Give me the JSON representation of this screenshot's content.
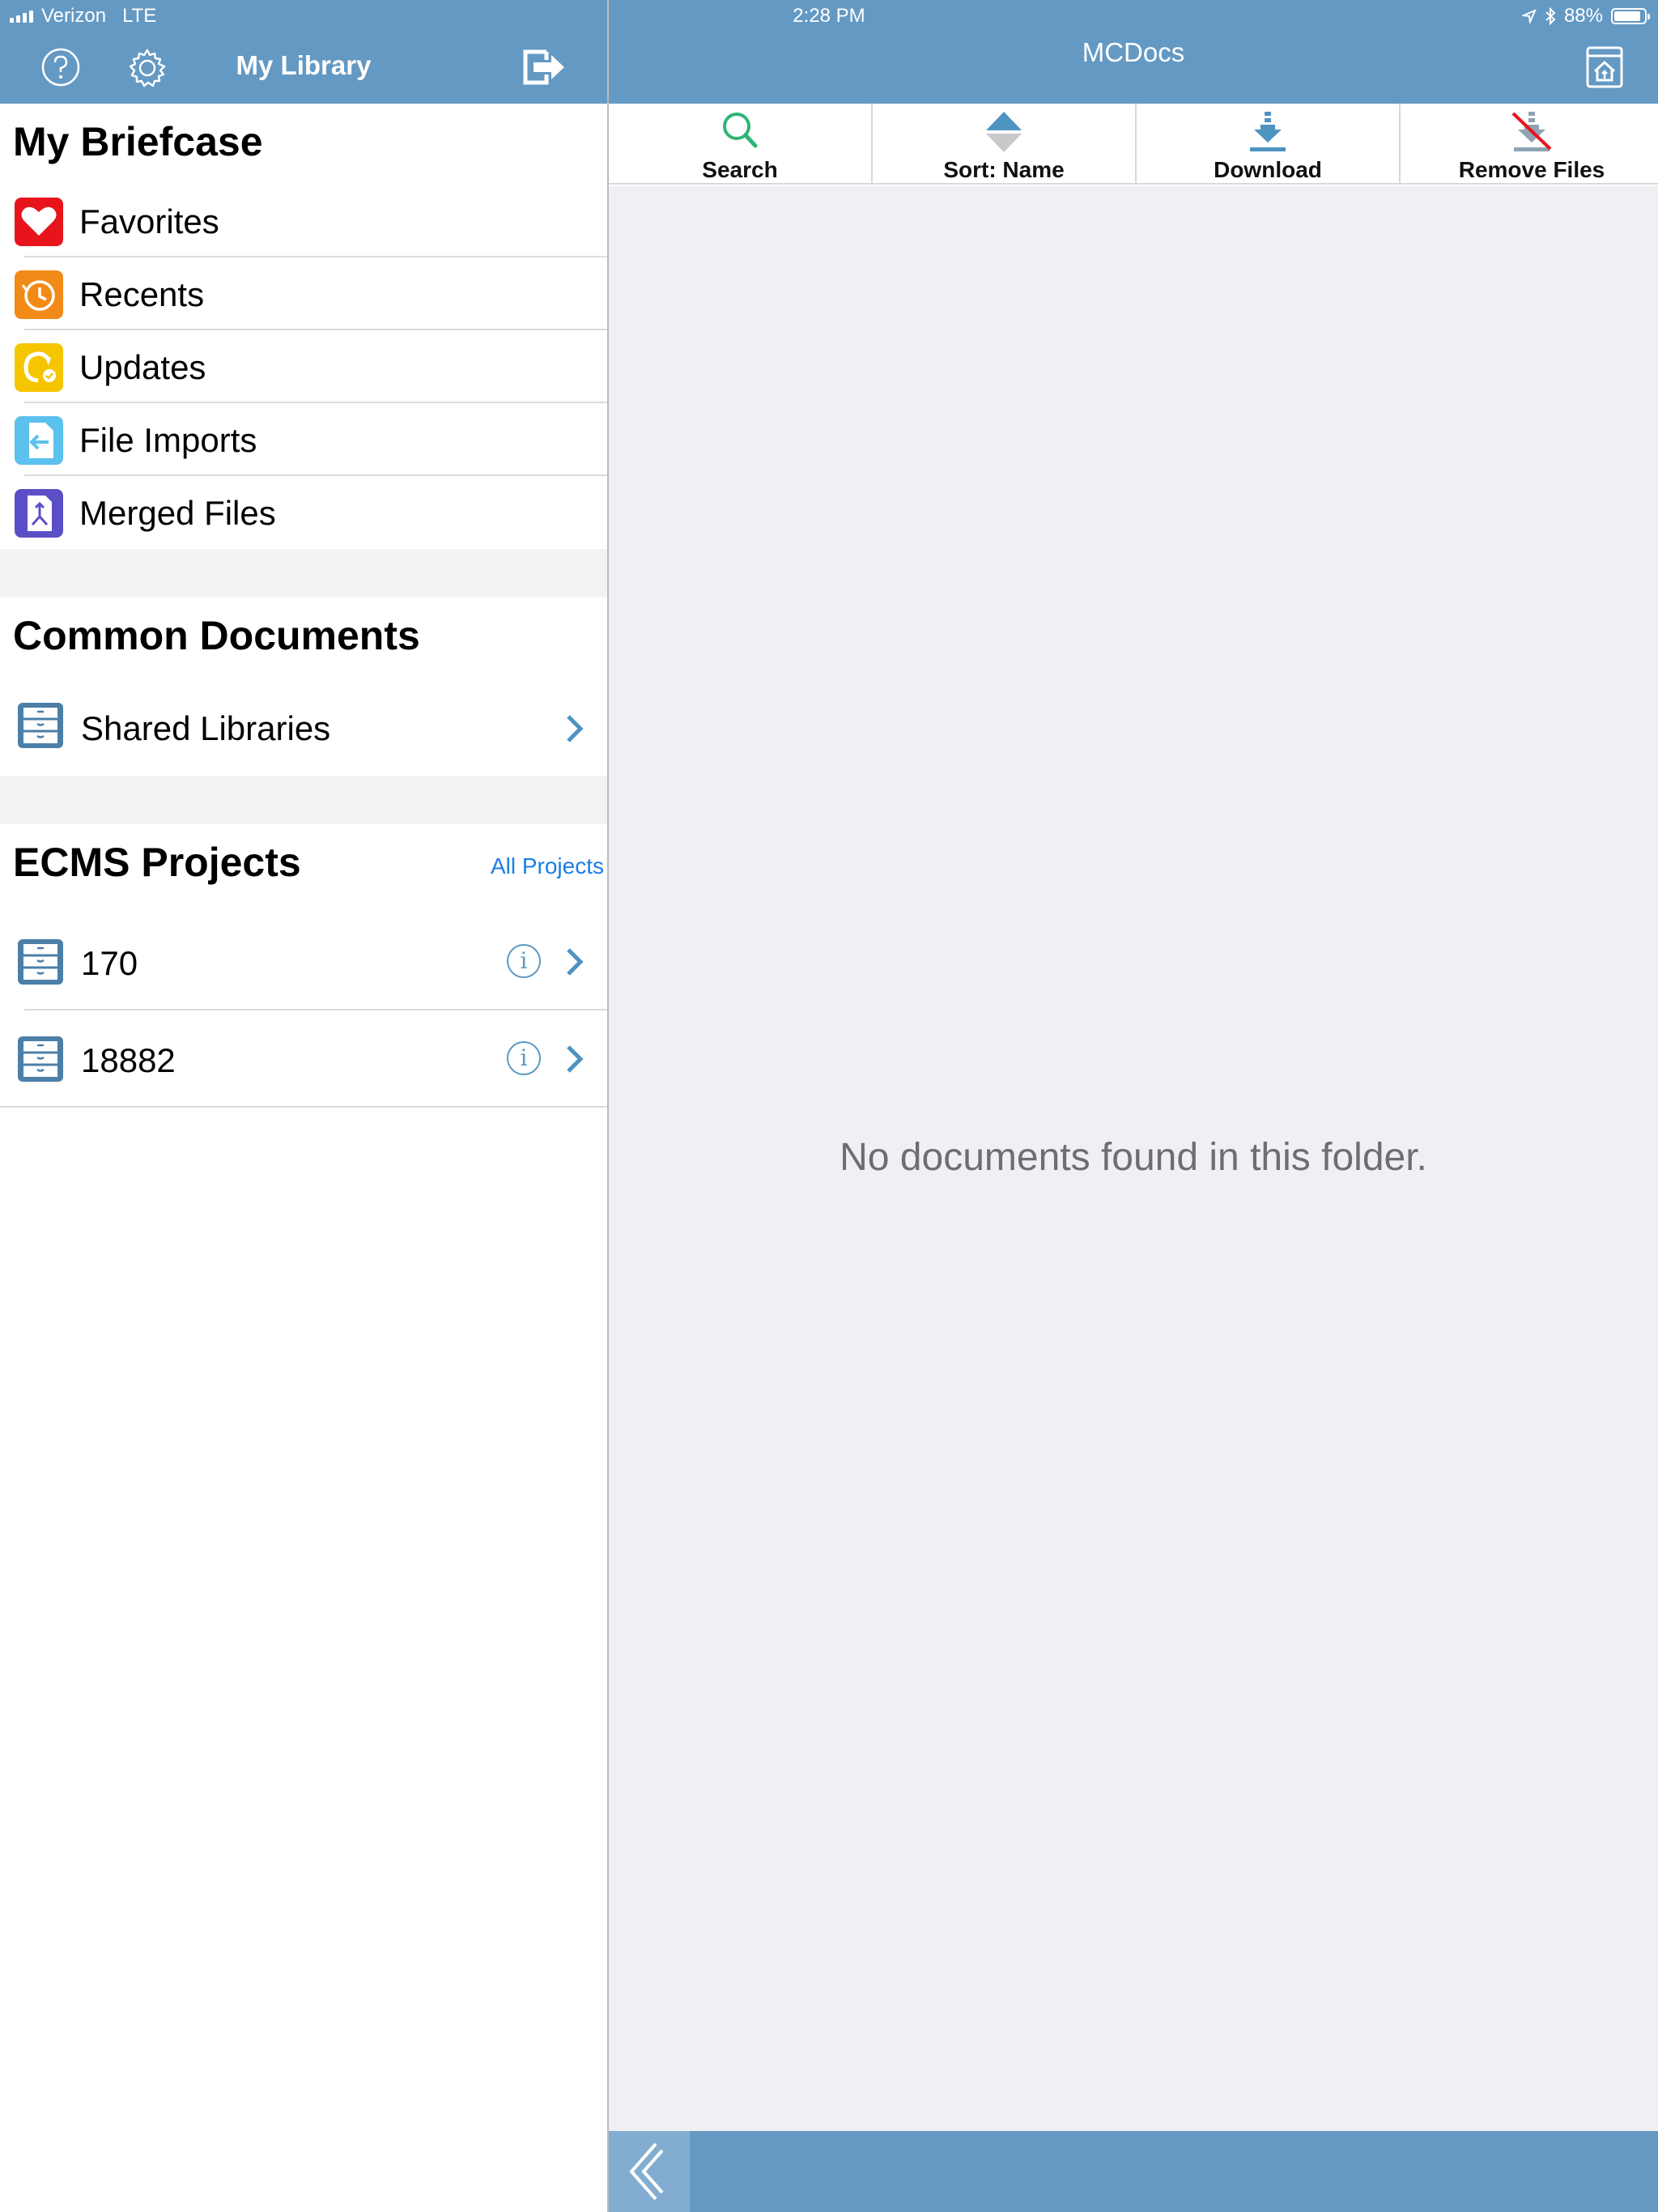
{
  "status_bar": {
    "carrier": "Verizon",
    "network": "LTE",
    "time": "2:28 PM",
    "battery": "88%",
    "battery_level": 0.88
  },
  "left_nav": {
    "title": "My Library",
    "icons": [
      "help-icon",
      "settings-icon",
      "logout-icon"
    ]
  },
  "right_nav": {
    "title": "MCDocs",
    "icons": [
      "home-icon"
    ]
  },
  "briefcase": {
    "title": "My Briefcase",
    "items": [
      {
        "label": "Favorites",
        "icon": "heart-icon",
        "color": "#e8141b"
      },
      {
        "label": "Recents",
        "icon": "clock-icon",
        "color": "#f28a17"
      },
      {
        "label": "Updates",
        "icon": "refresh-icon",
        "color": "#f5c500"
      },
      {
        "label": "File Imports",
        "icon": "import-icon",
        "color": "#5bc1ed"
      },
      {
        "label": "Merged Files",
        "icon": "merge-icon",
        "color": "#5a4fc6"
      }
    ]
  },
  "common": {
    "title": "Common Documents",
    "items": [
      {
        "label": "Shared Libraries",
        "icon": "cabinet-icon"
      }
    ]
  },
  "projects": {
    "title": "ECMS Projects",
    "link": "All Projects",
    "items": [
      {
        "label": "170",
        "icon": "cabinet-icon"
      },
      {
        "label": "18882",
        "icon": "cabinet-icon"
      }
    ]
  },
  "toolbar": {
    "search": "Search",
    "sort": "Sort: Name",
    "download": "Download",
    "remove": "Remove Files"
  },
  "main": {
    "empty_message": "No documents found in this folder."
  },
  "colors": {
    "bar": "#6499c3",
    "accent": "#5b9ac6",
    "link": "#1a7ee6"
  }
}
